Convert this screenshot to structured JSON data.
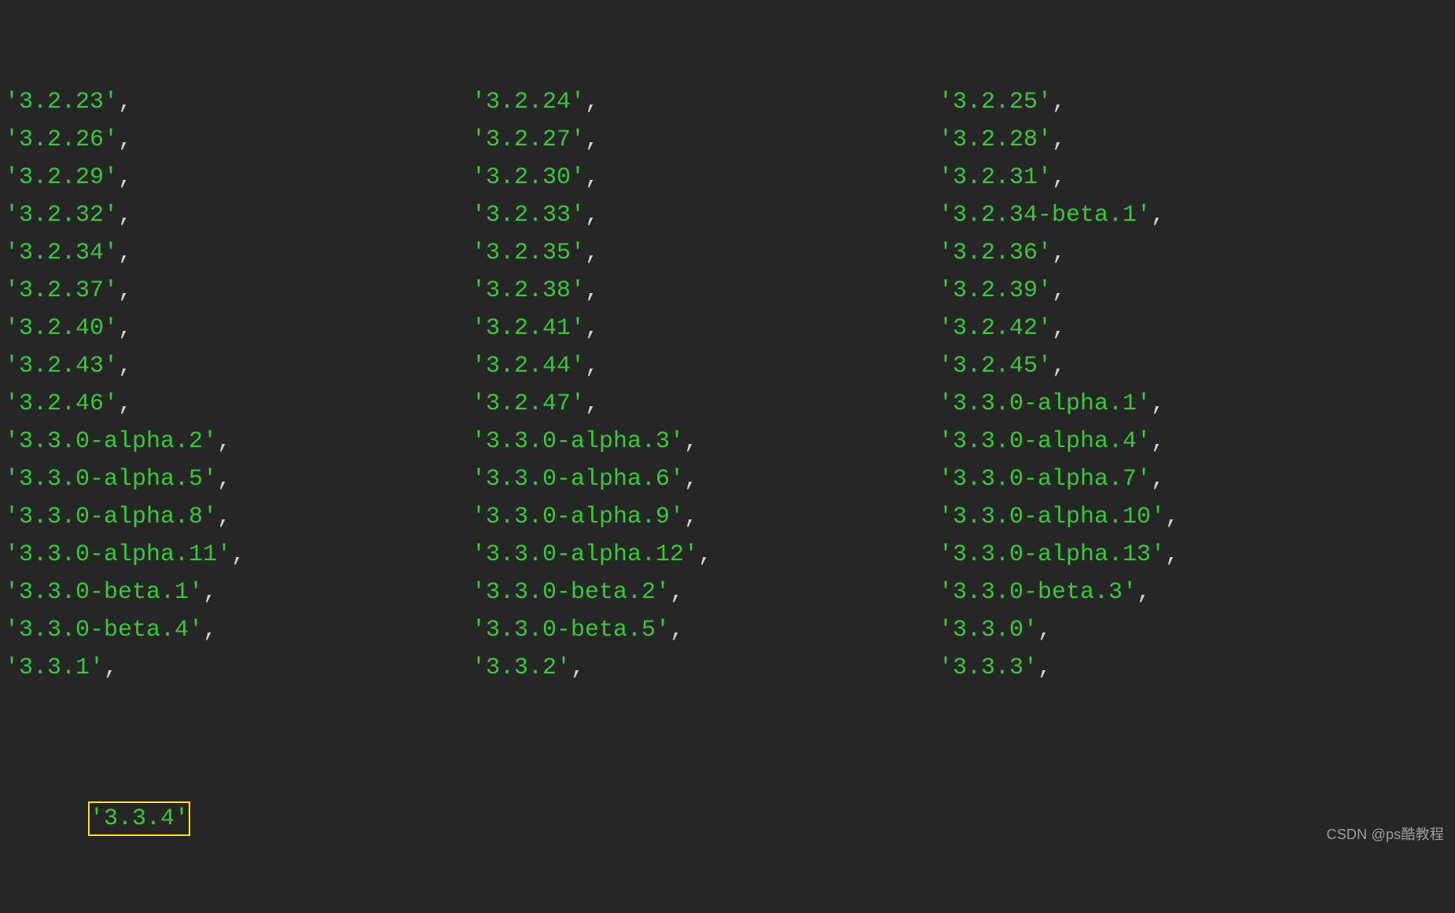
{
  "versions": [
    [
      "3.2.23",
      "3.2.24",
      "3.2.25"
    ],
    [
      "3.2.26",
      "3.2.27",
      "3.2.28"
    ],
    [
      "3.2.29",
      "3.2.30",
      "3.2.31"
    ],
    [
      "3.2.32",
      "3.2.33",
      "3.2.34-beta.1"
    ],
    [
      "3.2.34",
      "3.2.35",
      "3.2.36"
    ],
    [
      "3.2.37",
      "3.2.38",
      "3.2.39"
    ],
    [
      "3.2.40",
      "3.2.41",
      "3.2.42"
    ],
    [
      "3.2.43",
      "3.2.44",
      "3.2.45"
    ],
    [
      "3.2.46",
      "3.2.47",
      "3.3.0-alpha.1"
    ],
    [
      "3.3.0-alpha.2",
      "3.3.0-alpha.3",
      "3.3.0-alpha.4"
    ],
    [
      "3.3.0-alpha.5",
      "3.3.0-alpha.6",
      "3.3.0-alpha.7"
    ],
    [
      "3.3.0-alpha.8",
      "3.3.0-alpha.9",
      "3.3.0-alpha.10"
    ],
    [
      "3.3.0-alpha.11",
      "3.3.0-alpha.12",
      "3.3.0-alpha.13"
    ],
    [
      "3.3.0-beta.1",
      "3.3.0-beta.2",
      "3.3.0-beta.3"
    ],
    [
      "3.3.0-beta.4",
      "3.3.0-beta.5",
      "3.3.0"
    ],
    [
      "3.3.1",
      "3.3.2",
      "3.3.3"
    ]
  ],
  "last_version": "3.3.4",
  "watermark": "CSDN @ps酷教程"
}
